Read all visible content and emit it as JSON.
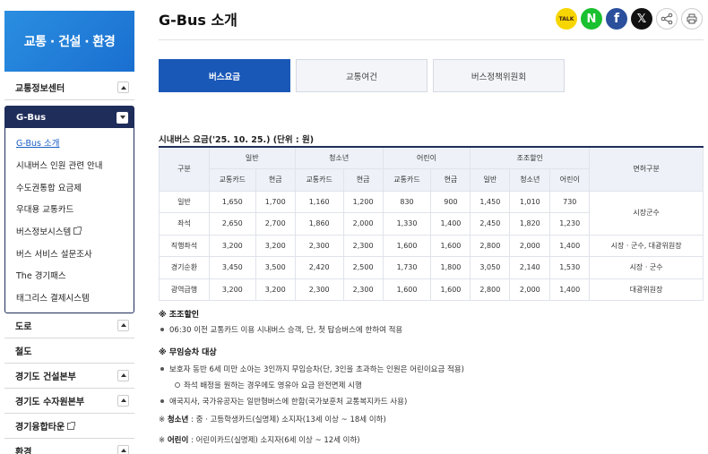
{
  "sidebar": {
    "banner": "교통 · 건설 · 환경",
    "top_item": "교통정보센터",
    "group_title": "G-Bus",
    "sub_items": [
      {
        "label": "G-Bus 소개",
        "active": true,
        "external": false
      },
      {
        "label": "시내버스 인원 관련 안내",
        "active": false,
        "external": false
      },
      {
        "label": "수도권통합 요금제",
        "active": false,
        "external": false
      },
      {
        "label": "우대용 교통카드",
        "active": false,
        "external": false
      },
      {
        "label": "버스정보시스템",
        "active": false,
        "external": true
      },
      {
        "label": "버스 서비스 설문조사",
        "active": false,
        "external": false
      },
      {
        "label": "The 경기패스",
        "active": false,
        "external": false
      },
      {
        "label": "태그리스 결제시스템",
        "active": false,
        "external": false
      }
    ],
    "bottom_items": [
      {
        "label": "도로",
        "arrow": true,
        "external": false
      },
      {
        "label": "철도",
        "arrow": false,
        "external": false
      },
      {
        "label": "경기도 건설본부",
        "arrow": true,
        "external": false
      },
      {
        "label": "경기도 수자원본부",
        "arrow": true,
        "external": false
      },
      {
        "label": "경기융합타운",
        "arrow": false,
        "external": true
      },
      {
        "label": "환경",
        "arrow": true,
        "external": false
      }
    ]
  },
  "header": {
    "title": "G-Bus 소개",
    "share": {
      "kakao": "TALK",
      "naver": "N",
      "facebook": "f",
      "x": "𝕏"
    }
  },
  "tabs": [
    "버스요금",
    "교통여건",
    "버스정책위원회"
  ],
  "fare": {
    "caption": "시내버스 요금('25. 10. 25.) (단위 : 원)",
    "head": {
      "kind": "구분",
      "groups": [
        "일반",
        "청소년",
        "어린이",
        "조조할인"
      ],
      "exempt": "면허구분",
      "card": "교통카드",
      "cash": "현금",
      "early_sub": [
        "일반",
        "청소년",
        "어린이"
      ]
    },
    "rows": [
      {
        "name": "일반",
        "vals": [
          "1,650",
          "1,700",
          "1,160",
          "1,200",
          "830",
          "900",
          "1,450",
          "1,010",
          "730"
        ],
        "license": "시장군수"
      },
      {
        "name": "좌석",
        "vals": [
          "2,650",
          "2,700",
          "1,860",
          "2,000",
          "1,330",
          "1,400",
          "2,450",
          "1,820",
          "1,230"
        ],
        "license": ""
      },
      {
        "name": "직행좌석",
        "vals": [
          "3,200",
          "3,200",
          "2,300",
          "2,300",
          "1,600",
          "1,600",
          "2,800",
          "2,000",
          "1,400"
        ],
        "license": "시장 · 군수, 대광위원장"
      },
      {
        "name": "경기순환",
        "vals": [
          "3,450",
          "3,500",
          "2,420",
          "2,500",
          "1,730",
          "1,800",
          "3,050",
          "2,140",
          "1,530"
        ],
        "license": "시장 · 군수"
      },
      {
        "name": "광역급행",
        "vals": [
          "3,200",
          "3,200",
          "2,300",
          "2,300",
          "1,600",
          "1,600",
          "2,800",
          "2,000",
          "1,400"
        ],
        "license": "대광위원장"
      }
    ]
  },
  "notes": {
    "early_title": "※ 조조할인",
    "early_text": "06:30 이전 교통카드 이용 시내버스 승객, 단, 첫 탑승버스에 한하여 적용",
    "free_title": "※ 무임승차 대상",
    "free_1": "보호자 동반 6세 미만 소아는 3인까지 무임승차(단, 3인을 초과하는 인원은 어린이요금 적용)",
    "free_1_sub": "좌석 배정을 원하는 경우에도 영유아 요금 완전면제 시행",
    "free_2": "애국지사, 국가유공자는 일반형버스에 한함(국가보훈처 교통복지카드 사용)",
    "youth_prefix": "※ ",
    "youth_label": "청소년",
    "youth_text": " : 중 · 고등학생카드(실명제) 소지자(13세 이상 ~ 18세 이하)",
    "child_prefix": "※ ",
    "child_label": "어린이",
    "child_text": " : 어린이카드(실명제) 소지자(6세 이상 ~ 12세 이하)"
  }
}
